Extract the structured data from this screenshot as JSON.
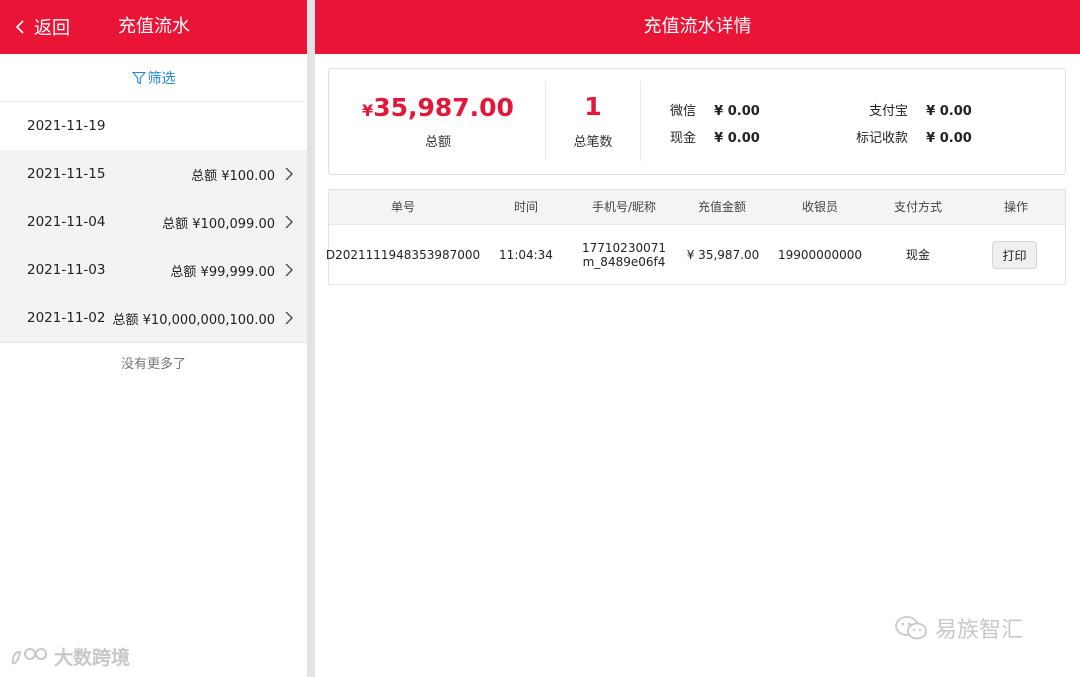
{
  "left": {
    "back_label": "返回",
    "title": "充值流水",
    "filter_label": "筛选",
    "rows": [
      {
        "date": "2021-11-19",
        "amount": ""
      },
      {
        "date": "2021-11-15",
        "amount": "总额 ¥100.00"
      },
      {
        "date": "2021-11-04",
        "amount": "总额 ¥100,099.00"
      },
      {
        "date": "2021-11-03",
        "amount": "总额 ¥99,999.00"
      },
      {
        "date": "2021-11-02",
        "amount": "总额 ¥10,000,000,100.00"
      }
    ],
    "no_more": "没有更多了",
    "watermark": "大数跨境"
  },
  "right": {
    "title": "充值流水详情",
    "summary": {
      "currency": "¥",
      "total_amount": "35,987.00",
      "total_label": "总额",
      "count": "1",
      "count_label": "总笔数",
      "payments": {
        "wechat_label": "微信",
        "wechat_value": "¥ 0.00",
        "cash_label": "现金",
        "cash_value": "¥ 0.00",
        "alipay_label": "支付宝",
        "alipay_value": "¥ 0.00",
        "marked_label": "标记收款",
        "marked_value": "¥ 0.00"
      }
    },
    "table": {
      "headers": [
        "单号",
        "时间",
        "手机号/昵称",
        "充值金额",
        "收银员",
        "支付方式",
        "操作"
      ],
      "row": {
        "order_no": "D2021111948353987000",
        "time": "11:04:34",
        "phone": "17710230071",
        "nickname": "m_8489e06f4",
        "amount": "¥ 35,987.00",
        "cashier": "19900000000",
        "pay_method": "现金",
        "action_label": "打印"
      }
    },
    "watermark": "易族智汇"
  },
  "colors": {
    "brand_red": "#ea1436",
    "amount_red": "#e3173a",
    "link_blue": "#1f86e0"
  }
}
